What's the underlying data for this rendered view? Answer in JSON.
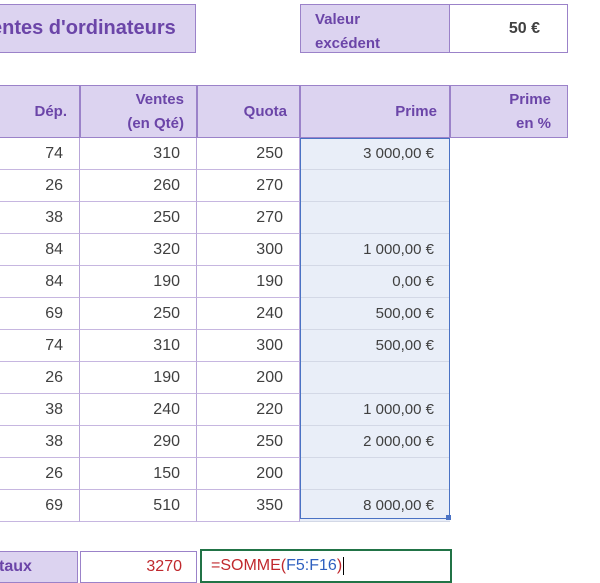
{
  "title": "entes d'ordinateurs",
  "valeur": {
    "label_line1": "Valeur",
    "label_line2": "excédent",
    "value": "50 €"
  },
  "headers": {
    "dep": "Dép.",
    "ventes_l1": "Ventes",
    "ventes_l2": "(en Qté)",
    "quota": "Quota",
    "prime": "Prime",
    "prime_pct_l1": "Prime",
    "prime_pct_l2": "en %"
  },
  "rows": [
    {
      "dep": "74",
      "ventes": "310",
      "quota": "250",
      "prime": "3 000,00 €"
    },
    {
      "dep": "26",
      "ventes": "260",
      "quota": "270",
      "prime": ""
    },
    {
      "dep": "38",
      "ventes": "250",
      "quota": "270",
      "prime": ""
    },
    {
      "dep": "84",
      "ventes": "320",
      "quota": "300",
      "prime": "1 000,00 €"
    },
    {
      "dep": "84",
      "ventes": "190",
      "quota": "190",
      "prime": "0,00 €"
    },
    {
      "dep": "69",
      "ventes": "250",
      "quota": "240",
      "prime": "500,00 €"
    },
    {
      "dep": "74",
      "ventes": "310",
      "quota": "300",
      "prime": "500,00 €"
    },
    {
      "dep": "26",
      "ventes": "190",
      "quota": "200",
      "prime": ""
    },
    {
      "dep": "38",
      "ventes": "240",
      "quota": "220",
      "prime": "1 000,00 €"
    },
    {
      "dep": "38",
      "ventes": "290",
      "quota": "250",
      "prime": "2 000,00 €"
    },
    {
      "dep": "26",
      "ventes": "150",
      "quota": "200",
      "prime": ""
    },
    {
      "dep": "69",
      "ventes": "510",
      "quota": "350",
      "prime": "8 000,00 €"
    }
  ],
  "totaux": {
    "label": "taux",
    "value": "3270"
  },
  "formula": {
    "prefix": "=SOMME(",
    "range": "F5:F16",
    "suffix": ")"
  },
  "colors": {
    "header_bg": "#dcd3f0",
    "header_text": "#6b45a8",
    "prime_bg": "#e9eef8",
    "formula_border": "#217346"
  }
}
